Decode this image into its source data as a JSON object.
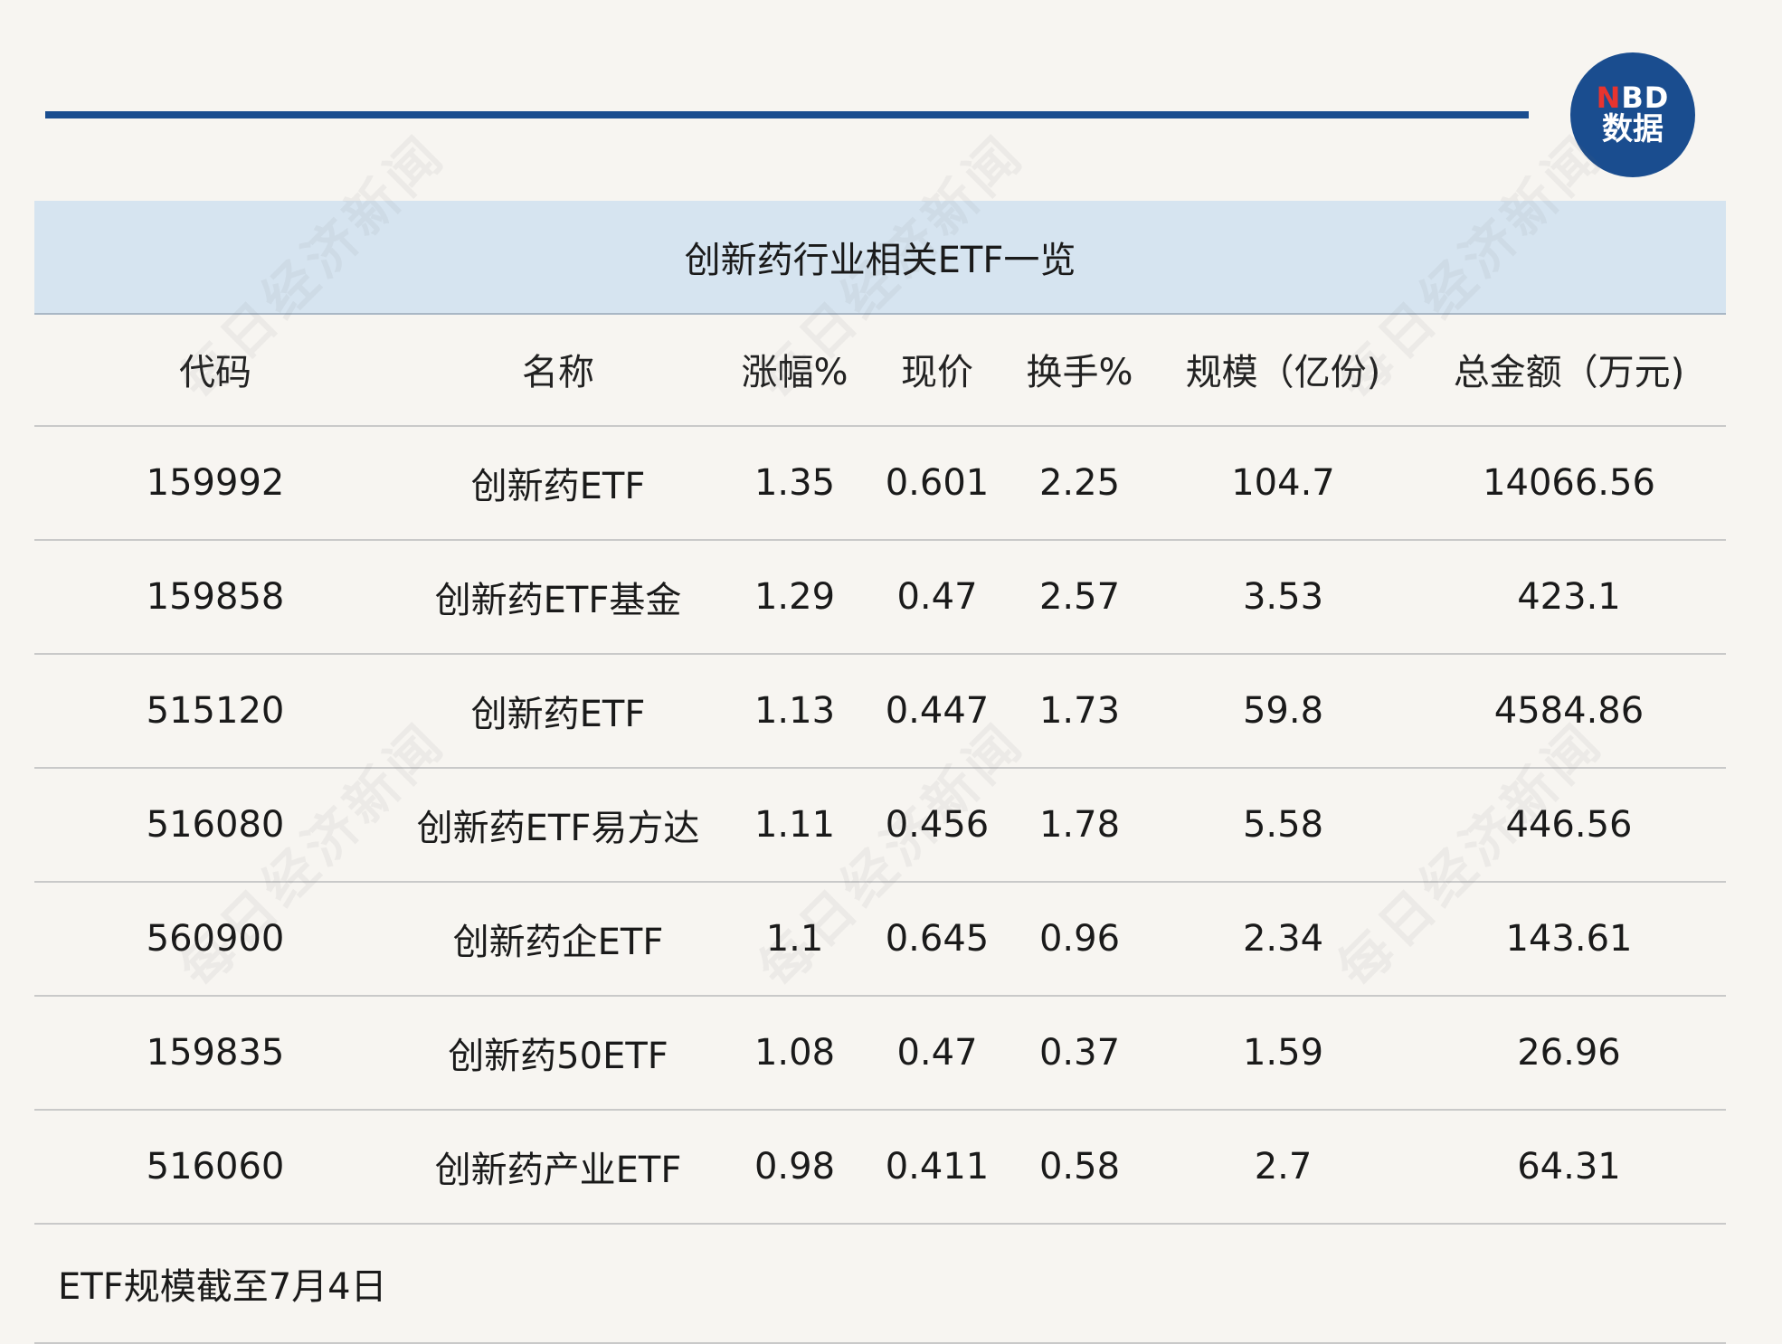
{
  "logo": {
    "mark_n": "N",
    "mark_bd": "BD",
    "sub": "数据"
  },
  "title": "创新药行业相关ETF一览",
  "headers": [
    "代码",
    "名称",
    "涨幅%",
    "现价",
    "换手%",
    "规模（亿份)",
    "总金额（万元)"
  ],
  "rows": [
    [
      "159992",
      "创新药ETF",
      "1.35",
      "0.601",
      "2.25",
      "104.7",
      "14066.56"
    ],
    [
      "159858",
      "创新药ETF基金",
      "1.29",
      "0.47",
      "2.57",
      "3.53",
      "423.1"
    ],
    [
      "515120",
      "创新药ETF",
      "1.13",
      "0.447",
      "1.73",
      "59.8",
      "4584.86"
    ],
    [
      "516080",
      "创新药ETF易方达",
      "1.11",
      "0.456",
      "1.78",
      "5.58",
      "446.56"
    ],
    [
      "560900",
      "创新药企ETF",
      "1.1",
      "0.645",
      "0.96",
      "2.34",
      "143.61"
    ],
    [
      "159835",
      "创新药50ETF",
      "1.08",
      "0.47",
      "0.37",
      "1.59",
      "26.96"
    ],
    [
      "516060",
      "创新药产业ETF",
      "0.98",
      "0.411",
      "0.58",
      "2.7",
      "64.31"
    ]
  ],
  "note": "ETF规模截至7月4日",
  "watermark": "每日经济新闻"
}
